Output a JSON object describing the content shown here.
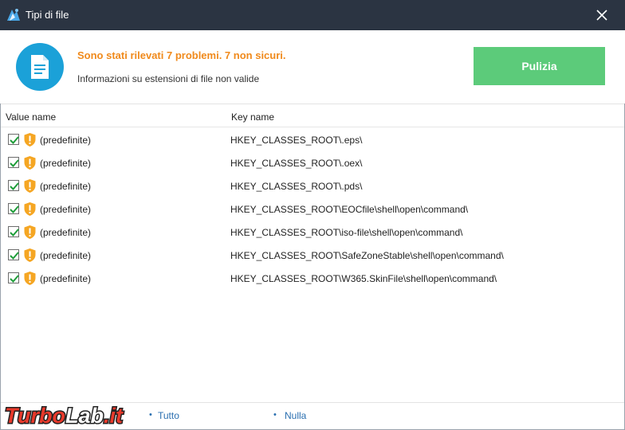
{
  "window": {
    "title": "Tipi di file",
    "icon": "app-logo-icon"
  },
  "header": {
    "headline": "Sono stati rilevati 7 problemi. 7 non sicuri.",
    "subline": "Informazioni su estensioni di file non valide",
    "clean_label": "Pulizia",
    "colors": {
      "accent": "#1ba1d8",
      "warning": "#f08a1c",
      "button": "#5ccb7a"
    }
  },
  "table": {
    "columns": [
      "Value name",
      "Key name"
    ],
    "rows": [
      {
        "checked": true,
        "value": "(predefinite)",
        "key": "HKEY_CLASSES_ROOT\\.eps\\"
      },
      {
        "checked": true,
        "value": "(predefinite)",
        "key": "HKEY_CLASSES_ROOT\\.oex\\"
      },
      {
        "checked": true,
        "value": "(predefinite)",
        "key": "HKEY_CLASSES_ROOT\\.pds\\"
      },
      {
        "checked": true,
        "value": "(predefinite)",
        "key": "HKEY_CLASSES_ROOT\\EOCfile\\shell\\open\\command\\"
      },
      {
        "checked": true,
        "value": "(predefinite)",
        "key": "HKEY_CLASSES_ROOT\\iso-file\\shell\\open\\command\\"
      },
      {
        "checked": true,
        "value": "(predefinite)",
        "key": "HKEY_CLASSES_ROOT\\SafeZoneStable\\shell\\open\\command\\"
      },
      {
        "checked": true,
        "value": "(predefinite)",
        "key": "HKEY_CLASSES_ROOT\\W365.SkinFile\\shell\\open\\command\\"
      }
    ]
  },
  "footer": {
    "select_all": "Tutto",
    "select_none": "Nulla"
  },
  "watermark": {
    "text_part1": "Turbo",
    "text_part2": "Lab",
    "text_part3": ".it"
  }
}
